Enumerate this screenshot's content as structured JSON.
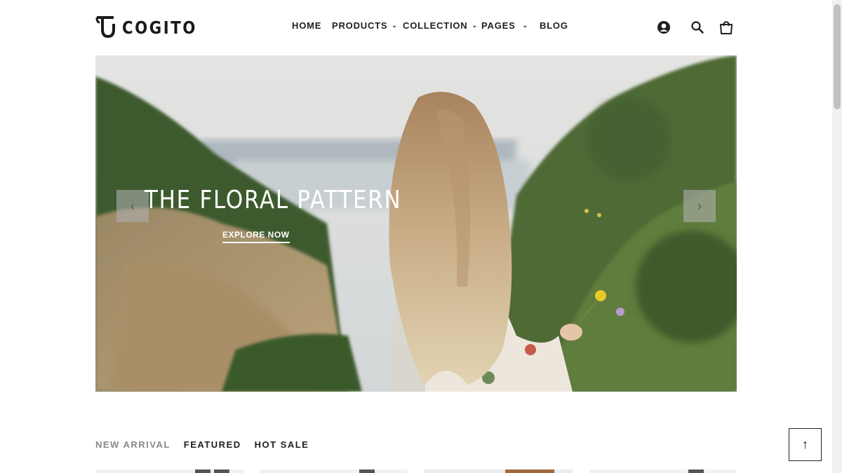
{
  "brand": {
    "name": "COGITO"
  },
  "nav": {
    "items": [
      {
        "label": "HOME",
        "has_dropdown": false
      },
      {
        "label": "PRODUCTS",
        "has_dropdown": true
      },
      {
        "label": "COLLECTION",
        "has_dropdown": true
      },
      {
        "label": "PAGES",
        "has_dropdown": true
      },
      {
        "label": "BLOG",
        "has_dropdown": false
      }
    ],
    "dropdown_glyph": "⌄"
  },
  "header_icons": [
    "account-icon",
    "search-icon",
    "cart-icon"
  ],
  "hero": {
    "title": "THE FLORAL PATTERN",
    "cta": "EXPLORE NOW",
    "prev_glyph": "‹",
    "next_glyph": "›"
  },
  "product_tabs": [
    {
      "label": "NEW ARRIVAL",
      "active": false
    },
    {
      "label": "FEATURED",
      "active": true
    },
    {
      "label": "HOT SALE",
      "active": true
    }
  ],
  "back_to_top": {
    "glyph": "↑"
  },
  "colors": {
    "text": "#1f1f1f",
    "muted_tab": "#8a8a8a",
    "hero_text": "#ffffff",
    "arrow_bg": "#afafaf"
  }
}
